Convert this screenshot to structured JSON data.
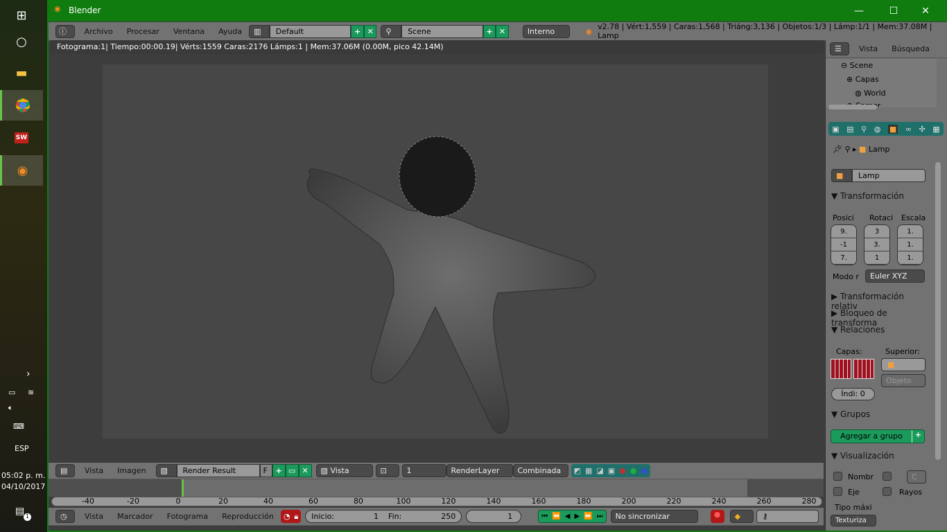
{
  "taskbar": {
    "language": "ESP",
    "time": "05:02 p. m.",
    "date": "04/10/2017",
    "notifications": "1"
  },
  "window": {
    "title": "Blender"
  },
  "info_header": {
    "menus": [
      "Archivo",
      "Procesar",
      "Ventana",
      "Ayuda"
    ],
    "layout": "Default",
    "scene": "Scene",
    "engine": "Interno",
    "stats": "v2.78 | Vért:1,559 | Caras:1,568 | Triáng:3,136 | Objetos:1/3 | Lámp:1/1 | Mem:37.08M | Lamp"
  },
  "render_info": "Fotograma:1| Tiempo:00:00.19| Vérts:1559 Caras:2176 Lámps:1 | Mem:37.06M (0.00M, pico 42.14M)",
  "outliner": {
    "tabs": [
      "Vista",
      "Búsqueda"
    ],
    "items": [
      "Scene",
      "Capas",
      "World",
      "Camer"
    ]
  },
  "properties": {
    "breadcrumb": "Lamp",
    "object_name": "Lamp",
    "transform": {
      "title": "Transformación",
      "cols": [
        "Posici",
        "Rotaci",
        "Escala"
      ],
      "pos": [
        "9.",
        "-1",
        "7."
      ],
      "rot": [
        "3",
        "3.",
        "1"
      ],
      "scale": [
        "1.",
        "1.",
        "1."
      ],
      "mode_label": "Modo r",
      "mode": "Euler XYZ"
    },
    "collapsed": [
      "Transformación relativ",
      "Bloqueo de transforma"
    ],
    "relations": {
      "title": "Relaciones",
      "layers": "Capas:",
      "parent": "Superior:",
      "parent_type": "Objeto",
      "index": "Índi:  0"
    },
    "groups": {
      "title": "Grupos",
      "add": "Agregar a grupo"
    },
    "display": {
      "title": "Visualización",
      "name": "Nombr",
      "axis": "Eje",
      "rays": "Rayos",
      "c": "C",
      "max_type": "Tipo máxi",
      "max_value": "Texturiza"
    }
  },
  "image_header": {
    "menus": [
      "Vista",
      "Imagen"
    ],
    "image": "Render Result",
    "f": "F",
    "view": "Vista",
    "slot": "1",
    "layer": "RenderLayer",
    "pass": "Combinada"
  },
  "timeline": {
    "ticks": [
      "-40",
      "-20",
      "0",
      "20",
      "40",
      "60",
      "80",
      "100",
      "120",
      "140",
      "160",
      "180",
      "200",
      "220",
      "240",
      "260",
      "280"
    ],
    "current_frame": 1
  },
  "timeline_header": {
    "menus": [
      "Vista",
      "Marcador",
      "Fotograma",
      "Reproducción"
    ],
    "start": "Inicio:",
    "start_val": "1",
    "end": "Fin:",
    "end_val": "250",
    "frame": "1",
    "sync": "No sincronizar"
  }
}
